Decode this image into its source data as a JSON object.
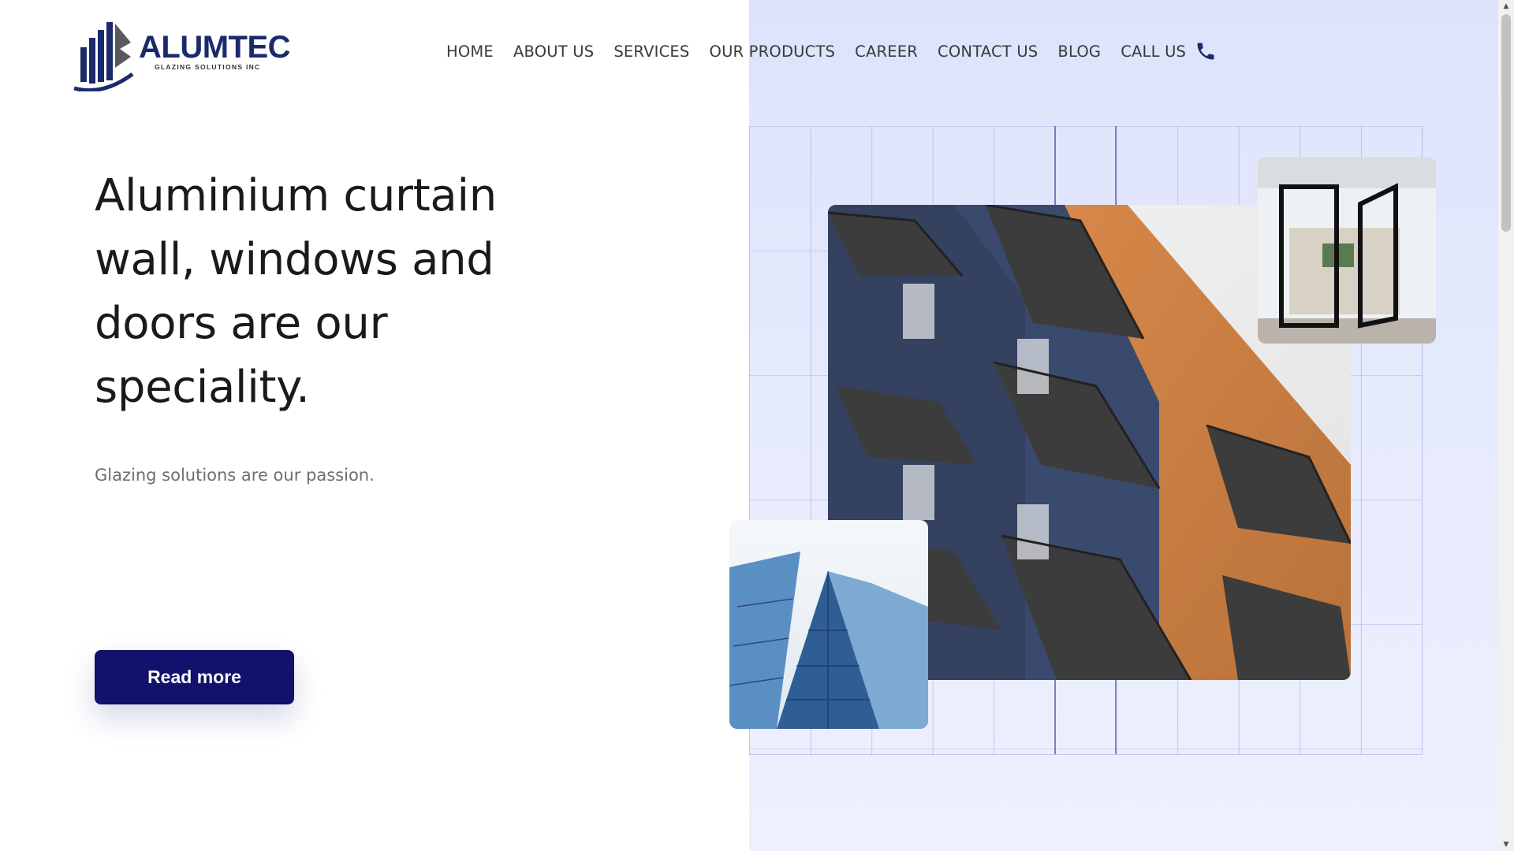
{
  "header": {
    "logo": {
      "brand": "ALUMTEC",
      "tagline": "GLAZING SOLUTIONS INC",
      "icon": "building-logo-icon"
    },
    "nav": [
      {
        "label": "HOME"
      },
      {
        "label": "ABOUT US"
      },
      {
        "label": "SERVICES"
      },
      {
        "label": "OUR PRODUCTS"
      },
      {
        "label": "CAREER"
      },
      {
        "label": "CONTACT US"
      },
      {
        "label": "BLOG"
      },
      {
        "label": "CALL US",
        "icon": "phone-icon"
      }
    ]
  },
  "hero": {
    "headline": "Aluminium curtain wall, windows and doors are our speciality.",
    "subtext": "Glazing solutions are our passion.",
    "cta_label": "Read more"
  },
  "images": {
    "main": "apartment-building-balconies-photo",
    "door": "glass-pivot-door-photo",
    "glass": "glass-skyscraper-photo"
  },
  "colors": {
    "primary": "#10126b",
    "brand": "#1b2a6b",
    "panel": "#dde3fb",
    "text": "#1a1a1a",
    "muted": "#6e6e6e"
  }
}
